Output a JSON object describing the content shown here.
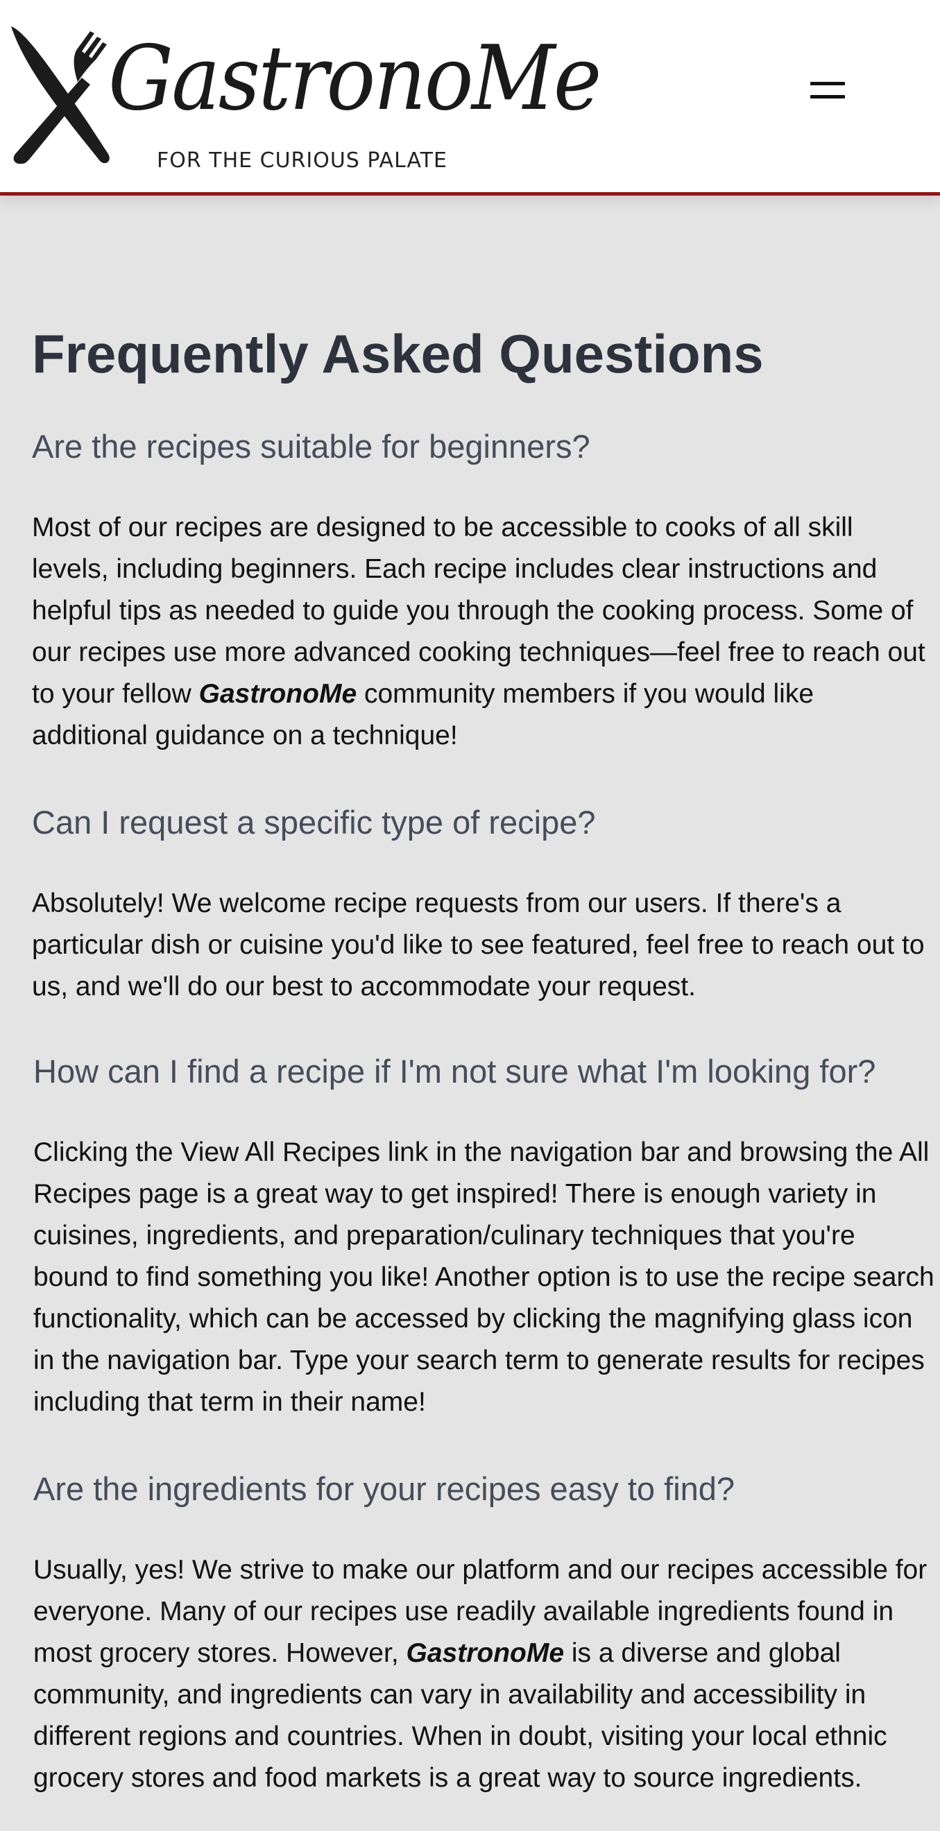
{
  "header": {
    "logo_wordmark": "GastronoMe",
    "logo_tagline": "FOR THE CURIOUS PALATE",
    "menu_icon": "hamburger-menu-icon"
  },
  "colors": {
    "accent": "#8e1616",
    "background": "#e4e4e5",
    "title": "#2e323d",
    "question": "#474c5a"
  },
  "page": {
    "title": "Frequently Asked Questions"
  },
  "faqs": [
    {
      "question": "Are the recipes suitable for beginners?",
      "answer_pre": "Most of our recipes are designed to be accessible to cooks of all skill levels, including beginners. Each recipe includes clear instructions and helpful tips as needed to guide you through the cooking process. Some of our recipes use more advanced cooking techniques—feel free to reach out to your fellow ",
      "answer_brand": "GastronoMe",
      "answer_post": " community members if you would like additional guidance on a technique!"
    },
    {
      "question": "Can I request a specific type of recipe?",
      "answer": "Absolutely! We welcome recipe requests from our users. If there's a particular dish or cuisine you'd like to see featured, feel free to reach out to us, and we'll do our best to accommodate your request."
    },
    {
      "question": "How can I find a recipe if I'm not sure what I'm looking for?",
      "answer": "Clicking the View All Recipes link in the navigation bar and browsing the All Recipes page is a great way to get inspired! There is enough variety in cuisines, ingredients, and preparation/culinary techniques that you're bound to find something you like! Another option is to use the recipe search functionality, which can be accessed by clicking the magnifying glass icon in the navigation bar. Type your search term to generate results for recipes including that term in their name!"
    },
    {
      "question": "Are the ingredients for your recipes easy to find?",
      "answer_pre": "Usually, yes! We strive to make our platform and our recipes accessible for everyone. Many of our recipes use readily available ingredients found in most grocery stores. However, ",
      "answer_brand": "GastronoMe",
      "answer_post": " is a diverse and global community, and ingredients can vary in availability and accessibility in different regions and countries. When in doubt, visiting your local ethnic grocery stores and food markets is a great way to source ingredients."
    }
  ]
}
